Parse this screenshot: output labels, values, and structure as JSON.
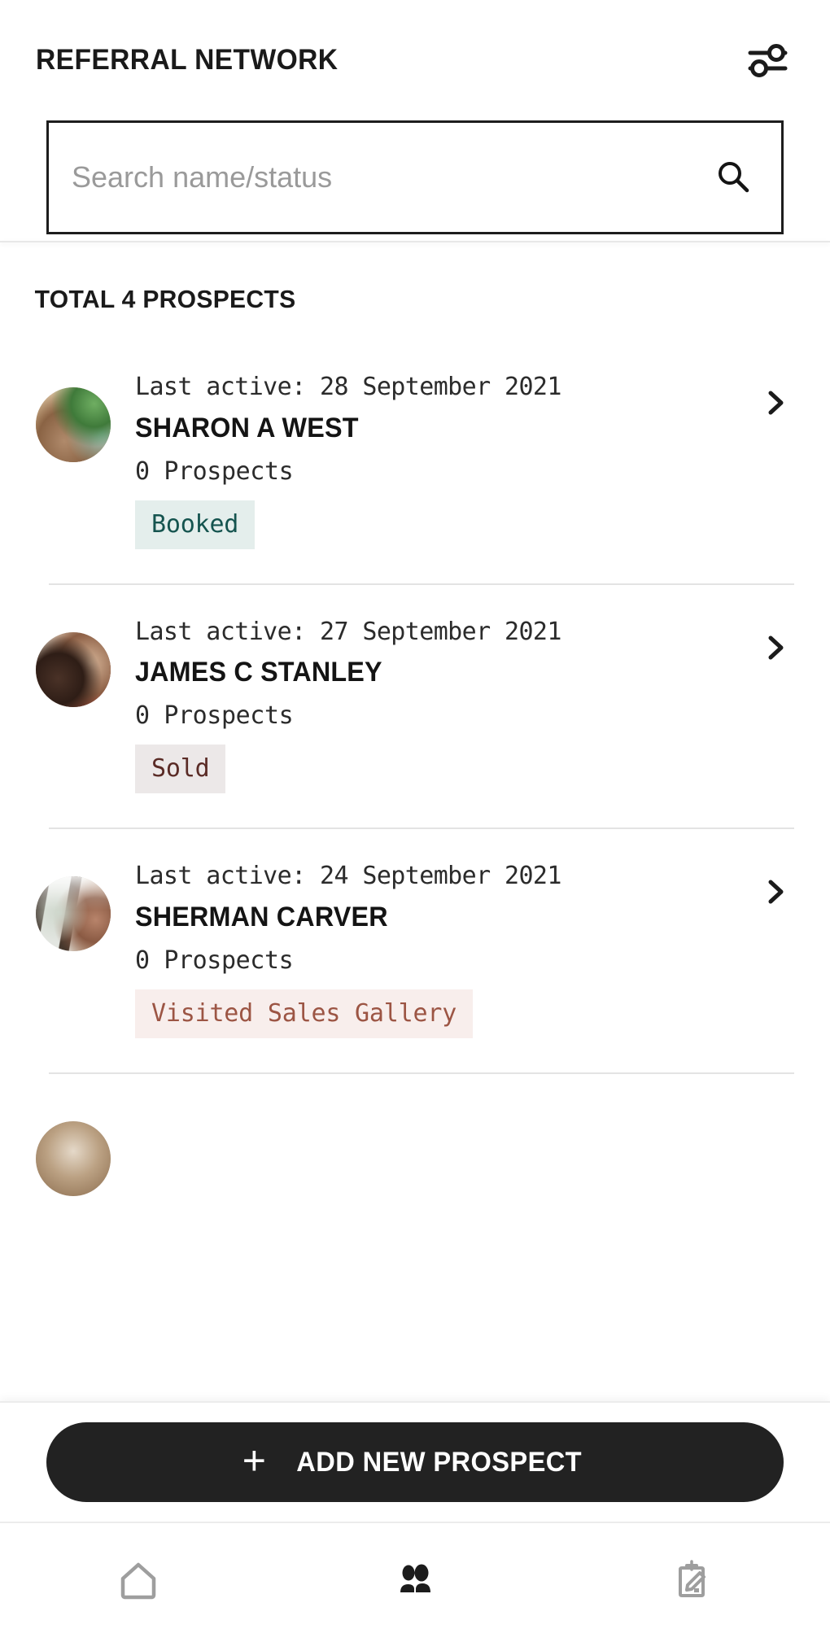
{
  "header": {
    "title": "REFERRAL NETWORK",
    "filter_icon": "sliders-filter-icon"
  },
  "search": {
    "placeholder": "Search name/status",
    "value": "",
    "icon": "search-icon"
  },
  "list": {
    "total_label": "TOTAL 4 PROSPECTS",
    "chevron_icon": "chevron-right-icon",
    "items": [
      {
        "last_active": "Last active: 28 September 2021",
        "name": "SHARON A WEST",
        "prospects": "0 Prospects",
        "status": "Booked",
        "status_bg": "#e4eeec",
        "status_fg": "#15544f",
        "avatar": "avatar-woman-garden"
      },
      {
        "last_active": "Last active: 27 September 2021",
        "name": "JAMES C STANLEY",
        "prospects": "0 Prospects",
        "status": "Sold",
        "status_bg": "#ece8e8",
        "status_fg": "#5a2b26",
        "avatar": "avatar-couple"
      },
      {
        "last_active": "Last active: 24 September 2021",
        "name": "SHERMAN CARVER",
        "prospects": "0 Prospects",
        "status": "Visited Sales Gallery",
        "status_bg": "#f8eeec",
        "status_fg": "#9c5544",
        "avatar": "avatar-window-house"
      }
    ]
  },
  "cta": {
    "plus": "+",
    "label": "ADD NEW PROSPECT"
  },
  "bottom_nav": {
    "items": [
      {
        "icon": "home-icon",
        "active": false
      },
      {
        "icon": "people-group-icon",
        "active": true
      },
      {
        "icon": "clipboard-edit-icon",
        "active": false
      }
    ]
  },
  "colors": {
    "accent_dark": "#222222",
    "text_primary": "#1a1a1a",
    "placeholder": "#9a9a9a",
    "divider": "#e3e3e3",
    "nav_inactive": "#9e9e9e",
    "nav_active": "#1c1c1c"
  }
}
